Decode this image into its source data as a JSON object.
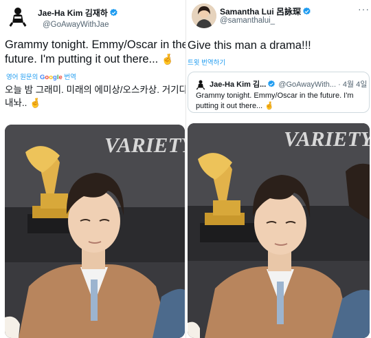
{
  "left_tweet": {
    "author": {
      "name": "Jae-Ha Kim 김재하",
      "handle": "@GoAwayWithJae"
    },
    "text_lines": [
      "Grammy tonight. Emmy/Oscar in the",
      "future. I'm putting it out there..."
    ],
    "emoji": "🤞",
    "translate": {
      "prefix": "영어 원문의 ",
      "google": [
        "G",
        "o",
        "o",
        "g",
        "l",
        "e"
      ],
      "suffix": " 번역"
    },
    "translation_lines": [
      "오늘 밤 그래미. 미래의 에미상/오스카상. 거기다",
      "내놔.."
    ],
    "translation_emoji": "🤞",
    "photo": {
      "watermark": "VARIETY",
      "subject_colors": {
        "suit": "#b8855d",
        "shirt": "#f3f3f3"
      }
    }
  },
  "right_tweet": {
    "author": {
      "name": "Samantha Lui 呂詠琛",
      "handle": "@samanthalui_"
    },
    "menu_icon": "more-horizontal",
    "text": "Give this man a drama!!!",
    "translate_label": "트윗 번역하기",
    "quote": {
      "author": {
        "name": "Jae-Ha Kim 김...",
        "handle": "@GoAwayWith...",
        "date": "· 4월 4일"
      },
      "text_lines": [
        "Grammy tonight. Emmy/Oscar in the future. I'm",
        "putting it out there..."
      ],
      "emoji": "🤞"
    },
    "photo": {
      "watermark": "VARIETY"
    }
  },
  "colors": {
    "link": "#1d9bf0",
    "muted": "#536471",
    "verified": "#1d9bf0",
    "border": "#cfd9de"
  }
}
